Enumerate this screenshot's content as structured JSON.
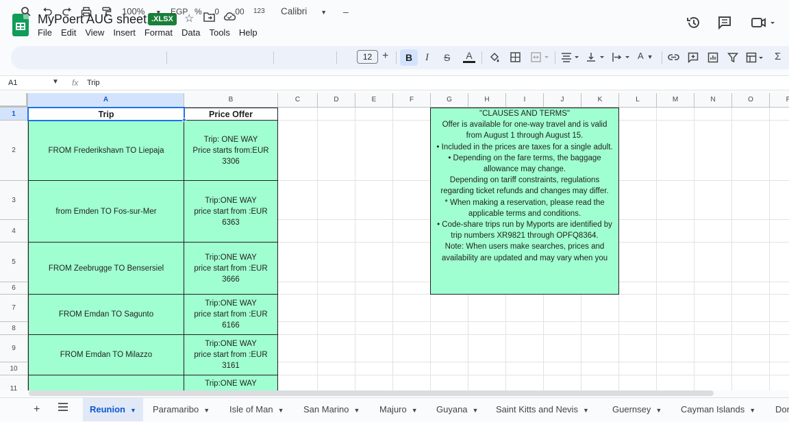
{
  "app": {
    "title": "MyPoert AUG sheet1",
    "file_badge": ".XLSX",
    "menu": [
      "File",
      "Edit",
      "View",
      "Insert",
      "Format",
      "Data",
      "Tools",
      "Help"
    ]
  },
  "toolbar": {
    "zoom": "100%",
    "currency": "EGP",
    "percent": "%",
    "decrease_decimals": ".0",
    "increase_decimals": ".00",
    "number_format": "123",
    "font": "Calibri",
    "font_size": "12",
    "minus": "–",
    "plus": "+"
  },
  "formula_bar": {
    "cell_ref": "A1",
    "fx": "fx",
    "content": "Trip"
  },
  "columns": [
    "A",
    "B",
    "C",
    "D",
    "E",
    "F",
    "G",
    "H",
    "I",
    "J",
    "K",
    "L",
    "M",
    "N",
    "O",
    "P"
  ],
  "rows": [
    "1",
    "2",
    "3",
    "4",
    "5",
    "6",
    "7",
    "8",
    "9",
    "10",
    "11"
  ],
  "table": {
    "headers": [
      "Trip",
      "Price Offer"
    ],
    "entries": [
      {
        "trip": "FROM Frederikshavn TO Liepaja",
        "offer": "Trip: ONE WAY\nPrice starts from:EUR\n3306"
      },
      {
        "trip": "from Emden TO Fos-sur-Mer",
        "offer": "Trip:ONE WAY\nprice start from :EUR\n6363"
      },
      {
        "trip": "FROM Zeebrugge  TO Bensersiel",
        "offer": "Trip:ONE WAY\nprice start from :EUR\n3666"
      },
      {
        "trip": "FROM Emdan TO Sagunto",
        "offer": "Trip:ONE WAY\nprice start from :EUR\n6166"
      },
      {
        "trip": "FROM Emdan TO Milazzo",
        "offer": "Trip:ONE WAY\nprice start from :EUR\n3161"
      },
      {
        "trip": "",
        "offer": "Trip:ONE WAY"
      }
    ]
  },
  "clauses": {
    "title": "\"CLAUSES AND TERMS\"",
    "lines": [
      "",
      "Offer is available for one-way travel and is valid from August 1 through August 15.",
      "",
      "• Included in the prices are taxes for a single adult.",
      "• Depending on the fare terms, the baggage allowance may change.",
      "Depending on tariff constraints, regulations regarding ticket refunds and changes may differ.",
      "* When making a reservation, please read the applicable terms and conditions.",
      "• Code-share trips run by Myports are identified by trip numbers XR9821 through OPFQ8364.",
      "Note: When users make searches, prices and availability are updated and may vary when you"
    ]
  },
  "sheets": [
    "Reunion",
    "Paramaribo",
    "Isle of Man",
    "San Marino",
    "Majuro",
    "Guyana",
    "Saint Kitts and Nevis",
    "Guernsey",
    "Cayman Islands",
    "Dor"
  ],
  "colors": {
    "cell_fill": "#a0ffd0",
    "selection": "#1a73e8",
    "badge": "#188038"
  }
}
